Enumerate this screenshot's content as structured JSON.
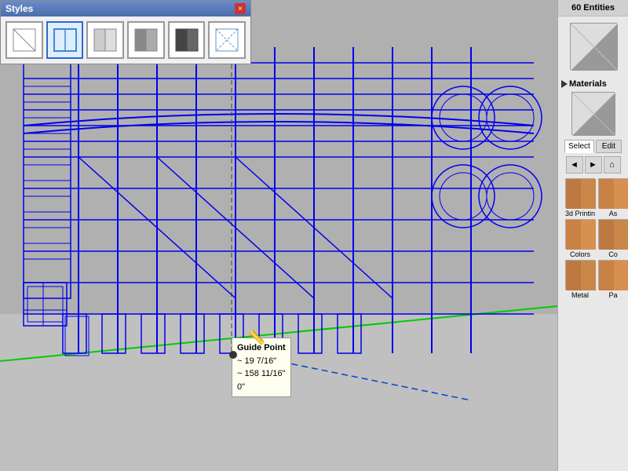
{
  "styles_panel": {
    "title": "Styles",
    "close_label": "×",
    "swatches": [
      {
        "id": "wireframe",
        "label": "Wireframe"
      },
      {
        "id": "hidden_line",
        "label": "Hidden Line"
      },
      {
        "id": "shaded",
        "label": "Shaded"
      },
      {
        "id": "shaded_textured",
        "label": "Shaded with Textures"
      },
      {
        "id": "monochrome",
        "label": "Monochrome"
      },
      {
        "id": "xray",
        "label": "X-Ray"
      }
    ],
    "active_index": 1
  },
  "guide_tooltip": {
    "title": "Guide Point",
    "line1": "~ 19 7/16\"",
    "line2": "~ 158 11/16\"",
    "line3": "0\""
  },
  "right_panel": {
    "entities_count": "60 Entities",
    "materials_header": "Materials",
    "tabs": [
      {
        "label": "Select",
        "active": true
      },
      {
        "label": "Edit",
        "active": false
      }
    ],
    "nav_buttons": [
      "◄",
      "►",
      "⌂"
    ],
    "material_items": [
      {
        "id": "3d_printing",
        "label": "3d Printin",
        "class": "mat-3d"
      },
      {
        "id": "as",
        "label": "As",
        "class": "mat-colors"
      },
      {
        "id": "colors",
        "label": "Colors",
        "class": "mat-colors"
      },
      {
        "id": "co",
        "label": "Co",
        "class": "mat-3d"
      },
      {
        "id": "metal",
        "label": "Metal",
        "class": "mat-metal"
      },
      {
        "id": "pa",
        "label": "Pa",
        "class": "mat-pa"
      }
    ]
  }
}
